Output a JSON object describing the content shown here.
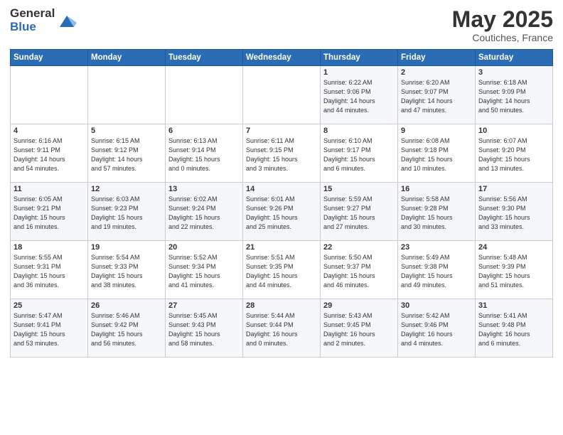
{
  "header": {
    "logo_line1": "General",
    "logo_line2": "Blue",
    "month": "May 2025",
    "location": "Coutiches, France"
  },
  "weekdays": [
    "Sunday",
    "Monday",
    "Tuesday",
    "Wednesday",
    "Thursday",
    "Friday",
    "Saturday"
  ],
  "weeks": [
    [
      {
        "day": "",
        "info": ""
      },
      {
        "day": "",
        "info": ""
      },
      {
        "day": "",
        "info": ""
      },
      {
        "day": "",
        "info": ""
      },
      {
        "day": "1",
        "info": "Sunrise: 6:22 AM\nSunset: 9:06 PM\nDaylight: 14 hours\nand 44 minutes."
      },
      {
        "day": "2",
        "info": "Sunrise: 6:20 AM\nSunset: 9:07 PM\nDaylight: 14 hours\nand 47 minutes."
      },
      {
        "day": "3",
        "info": "Sunrise: 6:18 AM\nSunset: 9:09 PM\nDaylight: 14 hours\nand 50 minutes."
      }
    ],
    [
      {
        "day": "4",
        "info": "Sunrise: 6:16 AM\nSunset: 9:11 PM\nDaylight: 14 hours\nand 54 minutes."
      },
      {
        "day": "5",
        "info": "Sunrise: 6:15 AM\nSunset: 9:12 PM\nDaylight: 14 hours\nand 57 minutes."
      },
      {
        "day": "6",
        "info": "Sunrise: 6:13 AM\nSunset: 9:14 PM\nDaylight: 15 hours\nand 0 minutes."
      },
      {
        "day": "7",
        "info": "Sunrise: 6:11 AM\nSunset: 9:15 PM\nDaylight: 15 hours\nand 3 minutes."
      },
      {
        "day": "8",
        "info": "Sunrise: 6:10 AM\nSunset: 9:17 PM\nDaylight: 15 hours\nand 6 minutes."
      },
      {
        "day": "9",
        "info": "Sunrise: 6:08 AM\nSunset: 9:18 PM\nDaylight: 15 hours\nand 10 minutes."
      },
      {
        "day": "10",
        "info": "Sunrise: 6:07 AM\nSunset: 9:20 PM\nDaylight: 15 hours\nand 13 minutes."
      }
    ],
    [
      {
        "day": "11",
        "info": "Sunrise: 6:05 AM\nSunset: 9:21 PM\nDaylight: 15 hours\nand 16 minutes."
      },
      {
        "day": "12",
        "info": "Sunrise: 6:03 AM\nSunset: 9:23 PM\nDaylight: 15 hours\nand 19 minutes."
      },
      {
        "day": "13",
        "info": "Sunrise: 6:02 AM\nSunset: 9:24 PM\nDaylight: 15 hours\nand 22 minutes."
      },
      {
        "day": "14",
        "info": "Sunrise: 6:01 AM\nSunset: 9:26 PM\nDaylight: 15 hours\nand 25 minutes."
      },
      {
        "day": "15",
        "info": "Sunrise: 5:59 AM\nSunset: 9:27 PM\nDaylight: 15 hours\nand 27 minutes."
      },
      {
        "day": "16",
        "info": "Sunrise: 5:58 AM\nSunset: 9:28 PM\nDaylight: 15 hours\nand 30 minutes."
      },
      {
        "day": "17",
        "info": "Sunrise: 5:56 AM\nSunset: 9:30 PM\nDaylight: 15 hours\nand 33 minutes."
      }
    ],
    [
      {
        "day": "18",
        "info": "Sunrise: 5:55 AM\nSunset: 9:31 PM\nDaylight: 15 hours\nand 36 minutes."
      },
      {
        "day": "19",
        "info": "Sunrise: 5:54 AM\nSunset: 9:33 PM\nDaylight: 15 hours\nand 38 minutes."
      },
      {
        "day": "20",
        "info": "Sunrise: 5:52 AM\nSunset: 9:34 PM\nDaylight: 15 hours\nand 41 minutes."
      },
      {
        "day": "21",
        "info": "Sunrise: 5:51 AM\nSunset: 9:35 PM\nDaylight: 15 hours\nand 44 minutes."
      },
      {
        "day": "22",
        "info": "Sunrise: 5:50 AM\nSunset: 9:37 PM\nDaylight: 15 hours\nand 46 minutes."
      },
      {
        "day": "23",
        "info": "Sunrise: 5:49 AM\nSunset: 9:38 PM\nDaylight: 15 hours\nand 49 minutes."
      },
      {
        "day": "24",
        "info": "Sunrise: 5:48 AM\nSunset: 9:39 PM\nDaylight: 15 hours\nand 51 minutes."
      }
    ],
    [
      {
        "day": "25",
        "info": "Sunrise: 5:47 AM\nSunset: 9:41 PM\nDaylight: 15 hours\nand 53 minutes."
      },
      {
        "day": "26",
        "info": "Sunrise: 5:46 AM\nSunset: 9:42 PM\nDaylight: 15 hours\nand 56 minutes."
      },
      {
        "day": "27",
        "info": "Sunrise: 5:45 AM\nSunset: 9:43 PM\nDaylight: 15 hours\nand 58 minutes."
      },
      {
        "day": "28",
        "info": "Sunrise: 5:44 AM\nSunset: 9:44 PM\nDaylight: 16 hours\nand 0 minutes."
      },
      {
        "day": "29",
        "info": "Sunrise: 5:43 AM\nSunset: 9:45 PM\nDaylight: 16 hours\nand 2 minutes."
      },
      {
        "day": "30",
        "info": "Sunrise: 5:42 AM\nSunset: 9:46 PM\nDaylight: 16 hours\nand 4 minutes."
      },
      {
        "day": "31",
        "info": "Sunrise: 5:41 AM\nSunset: 9:48 PM\nDaylight: 16 hours\nand 6 minutes."
      }
    ]
  ]
}
